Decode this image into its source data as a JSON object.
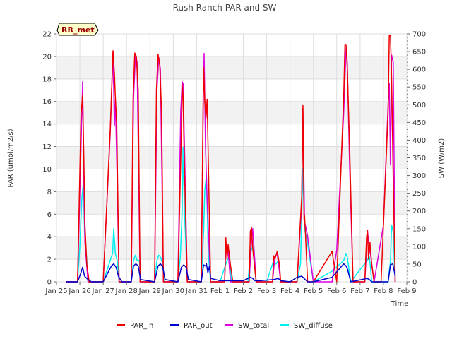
{
  "chart_data": {
    "type": "line",
    "title": "Rush Ranch PAR and SW",
    "xlabel": "Time",
    "ylabel": "PAR (umol/m2/s)",
    "y2label": "SW (W/m2)",
    "badge": "RR_met",
    "xlim": [
      0,
      15
    ],
    "ylim": [
      0,
      22
    ],
    "y2lim": [
      0,
      700
    ],
    "x_tick_values": [
      0,
      1,
      2,
      3,
      4,
      5,
      6,
      7,
      8,
      9,
      10,
      11,
      12,
      13,
      14,
      15
    ],
    "x_ticks": [
      "Jan 25",
      "Jan 26",
      "Jan 27",
      "Jan 28",
      "Jan 29",
      "Jan 30",
      "Jan 31",
      "Feb 1",
      "Feb 2",
      "Feb 3",
      "Feb 4",
      "Feb 5",
      "Feb 6",
      "Feb 7",
      "Feb 8",
      "Feb 9"
    ],
    "y_ticks": [
      0,
      2,
      4,
      6,
      8,
      10,
      12,
      14,
      16,
      18,
      20,
      22
    ],
    "y2_ticks": [
      0,
      50,
      100,
      150,
      200,
      250,
      300,
      350,
      400,
      450,
      500,
      550,
      600,
      650,
      700
    ],
    "grid": true,
    "legend_position": "bottom",
    "series": [
      {
        "name": "PAR_in",
        "color": "#ee0000",
        "axis": "left",
        "x": [
          0.4,
          0.9,
          1.05,
          1.12,
          1.18,
          1.22,
          1.3,
          1.4,
          1.55,
          2.0,
          2.3,
          2.42,
          2.48,
          2.52,
          2.58,
          2.68,
          2.9,
          3.2,
          3.28,
          3.35,
          3.42,
          3.5,
          3.58,
          3.9,
          4.2,
          4.28,
          4.35,
          4.42,
          4.5,
          4.58,
          4.9,
          5.2,
          5.28,
          5.35,
          5.38,
          5.42,
          5.48,
          5.6,
          5.9,
          6.2,
          6.28,
          6.3,
          6.35,
          6.4,
          6.45,
          6.5,
          6.6,
          7.0,
          7.2,
          7.25,
          7.3,
          7.35,
          7.45,
          7.55,
          8.0,
          8.25,
          8.3,
          8.35,
          8.4,
          8.55,
          8.7,
          9.25,
          9.3,
          9.35,
          9.45,
          9.55,
          9.6,
          9.7,
          10.3,
          10.5,
          10.55,
          10.6,
          10.62,
          10.66,
          10.75,
          11.0,
          11.8,
          12.0,
          12.3,
          12.35,
          12.4,
          12.45,
          12.55,
          12.7,
          13.2,
          13.28,
          13.32,
          13.36,
          13.42,
          13.5,
          13.6,
          13.9,
          14.0,
          14.2,
          14.25,
          14.3,
          14.35,
          14.42,
          14.5
        ],
        "y": [
          0,
          0,
          14.8,
          16.6,
          10,
          5,
          1.5,
          0,
          0,
          0,
          13.5,
          20.5,
          18.5,
          16.4,
          14,
          0,
          0,
          0,
          16.5,
          20.3,
          20,
          17,
          0,
          0,
          0,
          17,
          20.2,
          19.2,
          15,
          0,
          0,
          0,
          7.3,
          13.5,
          17.5,
          16.4,
          10,
          0,
          0,
          0,
          16.5,
          19,
          16,
          14.5,
          16.2,
          11,
          0,
          0,
          0,
          3.9,
          2,
          3.3,
          1.5,
          0,
          0,
          0,
          4.5,
          4.8,
          3,
          0,
          0,
          0,
          2.3,
          2,
          2.7,
          1.5,
          0,
          0,
          0,
          7.5,
          15.7,
          5.5,
          5.9,
          4.3,
          0,
          0,
          2.7,
          0,
          16.5,
          21,
          21,
          19,
          12,
          0,
          0,
          4,
          4.6,
          2,
          3.5,
          1.5,
          0,
          0,
          5,
          15,
          21.9,
          21.8,
          18,
          9,
          0
        ]
      },
      {
        "name": "PAR_out",
        "color": "#0000cc",
        "axis": "left",
        "x": [
          0.4,
          0.9,
          1.05,
          1.12,
          1.2,
          1.35,
          1.5,
          2.0,
          2.35,
          2.45,
          2.55,
          2.65,
          2.8,
          3.2,
          3.3,
          3.4,
          3.5,
          3.6,
          4.2,
          4.35,
          4.45,
          4.55,
          4.65,
          5.2,
          5.35,
          5.45,
          5.55,
          5.65,
          6.2,
          6.3,
          6.38,
          6.42,
          6.48,
          6.55,
          6.6,
          7.0,
          7.5,
          8.0,
          8.3,
          8.4,
          8.5,
          8.7,
          9.3,
          9.5,
          9.6,
          10.0,
          10.3,
          10.5,
          10.6,
          10.75,
          11.0,
          11.8,
          12.3,
          12.4,
          12.45,
          12.6,
          13.3,
          13.4,
          13.5,
          14.2,
          14.3,
          14.4,
          14.5
        ],
        "y": [
          0,
          0,
          0.8,
          1.3,
          0.5,
          0.2,
          0,
          0,
          1.4,
          1.6,
          1.3,
          0.5,
          0,
          0,
          1.4,
          1.6,
          1.4,
          0.2,
          0,
          1.4,
          1.6,
          1.3,
          0.2,
          0,
          1.3,
          1.5,
          1.3,
          0.2,
          0,
          1.5,
          1.4,
          1.6,
          0.8,
          1.4,
          0.3,
          0.1,
          0.1,
          0.1,
          0.4,
          0.3,
          0.1,
          0.1,
          0.2,
          0.3,
          0.1,
          0,
          0.4,
          0.5,
          0.3,
          0,
          0,
          0.4,
          1.6,
          1.4,
          1.2,
          0,
          0.3,
          0.2,
          0,
          0,
          1.5,
          1.6,
          0.5
        ]
      },
      {
        "name": "SW_total",
        "color": "#dd00dd",
        "axis": "right",
        "x": [
          0.4,
          0.9,
          1.05,
          1.12,
          1.18,
          1.22,
          1.35,
          2.0,
          2.3,
          2.42,
          2.48,
          2.52,
          2.6,
          2.68,
          3.2,
          3.3,
          3.38,
          3.45,
          3.58,
          4.2,
          4.3,
          4.38,
          4.45,
          4.58,
          5.2,
          5.32,
          5.38,
          5.42,
          5.5,
          5.6,
          6.2,
          6.28,
          6.32,
          6.38,
          6.45,
          6.6,
          7.2,
          7.25,
          7.35,
          7.45,
          8.25,
          8.35,
          8.4,
          8.55,
          9.25,
          9.35,
          9.45,
          9.6,
          10.3,
          10.5,
          10.55,
          10.62,
          10.75,
          11.0,
          11.8,
          12.0,
          12.3,
          12.4,
          12.45,
          12.55,
          12.7,
          13.2,
          13.32,
          13.42,
          13.6,
          14.0,
          14.2,
          14.25,
          14.3,
          14.35,
          14.42,
          14.5
        ],
        "y": [
          0,
          0,
          380,
          565,
          250,
          110,
          0,
          0,
          420,
          650,
          440,
          520,
          280,
          0,
          0,
          520,
          640,
          620,
          0,
          0,
          540,
          635,
          600,
          0,
          0,
          480,
          565,
          560,
          320,
          0,
          0,
          490,
          645,
          380,
          230,
          0,
          0,
          110,
          90,
          0,
          0,
          120,
          150,
          0,
          0,
          70,
          80,
          0,
          0,
          220,
          490,
          170,
          130,
          0,
          0,
          90,
          480,
          660,
          620,
          330,
          0,
          0,
          140,
          90,
          0,
          160,
          500,
          560,
          330,
          640,
          620,
          0
        ]
      },
      {
        "name": "SW_diffuse",
        "color": "#00eeee",
        "axis": "right",
        "x": [
          0.4,
          0.9,
          1.0,
          1.08,
          1.15,
          1.2,
          1.3,
          1.35,
          1.6,
          2.0,
          2.3,
          2.4,
          2.45,
          2.52,
          2.6,
          2.68,
          2.75,
          3.0,
          3.2,
          3.3,
          3.38,
          3.45,
          3.55,
          3.6,
          4.2,
          4.3,
          4.38,
          4.45,
          4.55,
          4.6,
          5.2,
          5.3,
          5.38,
          5.42,
          5.48,
          5.6,
          6.2,
          6.3,
          6.35,
          6.42,
          6.5,
          6.6,
          7.0,
          7.3,
          7.4,
          7.5,
          8.2,
          8.3,
          8.4,
          8.55,
          9.0,
          9.3,
          9.4,
          9.5,
          9.6,
          10.3,
          10.45,
          10.55,
          10.62,
          10.75,
          11.0,
          11.8,
          12.3,
          12.4,
          12.45,
          12.6,
          13.3,
          13.4,
          13.5,
          14.2,
          14.3,
          14.35,
          14.42,
          14.5
        ],
        "y": [
          0,
          0,
          100,
          230,
          280,
          140,
          60,
          0,
          0,
          0,
          60,
          80,
          150,
          80,
          60,
          0,
          0,
          0,
          0,
          60,
          75,
          60,
          60,
          0,
          0,
          60,
          75,
          70,
          50,
          0,
          0,
          70,
          200,
          380,
          200,
          0,
          0,
          140,
          260,
          300,
          80,
          0,
          0,
          60,
          70,
          0,
          0,
          80,
          100,
          0,
          0,
          60,
          50,
          60,
          0,
          0,
          50,
          320,
          150,
          110,
          0,
          30,
          60,
          80,
          70,
          0,
          60,
          70,
          0,
          0,
          60,
          160,
          140,
          0
        ]
      }
    ]
  },
  "legend": {
    "items": [
      {
        "label": "PAR_in",
        "color": "#ee0000"
      },
      {
        "label": "PAR_out",
        "color": "#0000cc"
      },
      {
        "label": "SW_total",
        "color": "#dd00dd"
      },
      {
        "label": "SW_diffuse",
        "color": "#00eeee"
      }
    ]
  }
}
